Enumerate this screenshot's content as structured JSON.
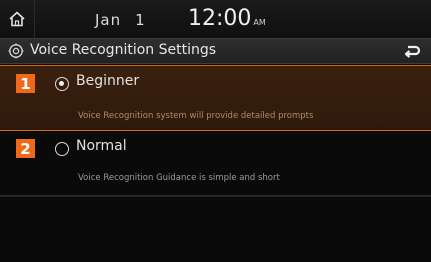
{
  "status_bar": {
    "month": "Jan",
    "day": "1",
    "time": "12:00",
    "ampm": "AM"
  },
  "header": {
    "title": "Voice Recognition Settings"
  },
  "options": [
    {
      "badge": "1",
      "label": "Beginner",
      "description": "Voice Recognition system will provide detailed prompts",
      "selected": true
    },
    {
      "badge": "2",
      "label": "Normal",
      "description": "Voice Recognition Guidance is simple and short",
      "selected": false
    }
  ],
  "colors": {
    "accent": "#ee6a1a",
    "selected_bg": "#3a200e"
  },
  "icons": {
    "home": "home-icon",
    "settings": "gear-icon",
    "back": "back-arrow-icon"
  }
}
